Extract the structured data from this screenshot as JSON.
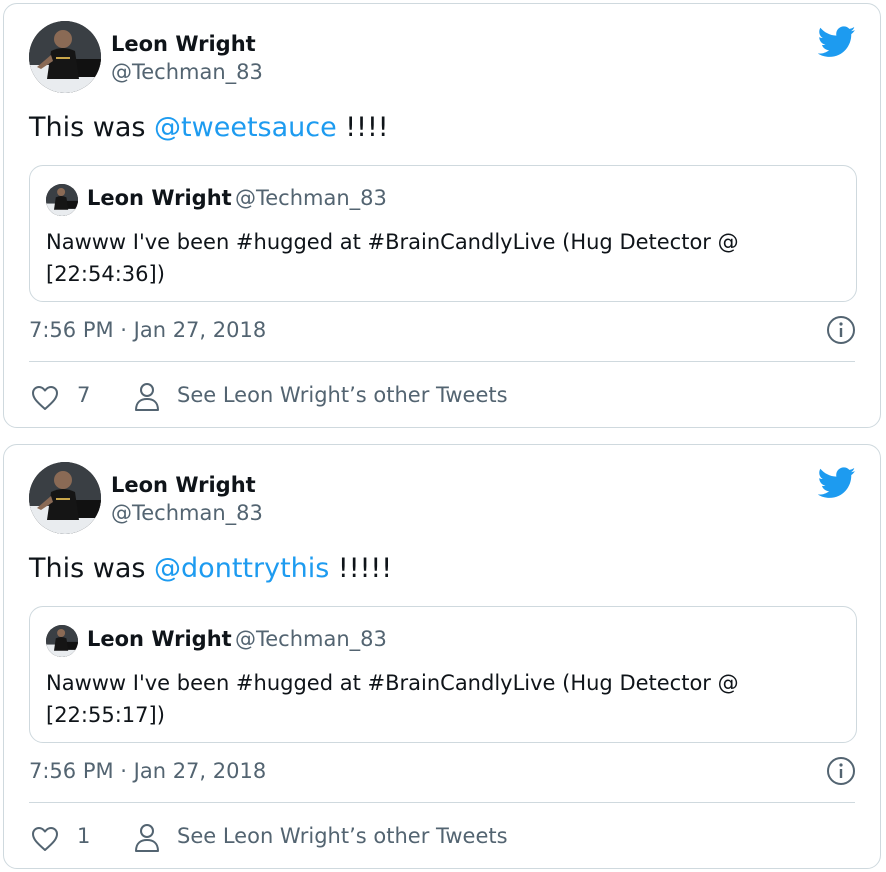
{
  "tweets": [
    {
      "author_name": "Leon Wright",
      "author_handle": "@Techman_83",
      "text_prefix": "This was ",
      "mention": "@tweetsauce",
      "text_suffix": " !!!!",
      "quote": {
        "author_name": "Leon Wright",
        "author_handle": "@Techman_83",
        "text": "Nawww I've been #hugged at #BrainCandlyLive (Hug Detector @ [22:54:36])"
      },
      "timestamp": "7:56 PM · Jan 27, 2018",
      "likes": "7",
      "other_tweets_label": "See Leon Wright’s other Tweets"
    },
    {
      "author_name": "Leon Wright",
      "author_handle": "@Techman_83",
      "text_prefix": "This was ",
      "mention": "@donttrythis",
      "text_suffix": " !!!!!",
      "quote": {
        "author_name": "Leon Wright",
        "author_handle": "@Techman_83",
        "text": "Nawww I've been #hugged at #BrainCandlyLive (Hug Detector @ [22:55:17])"
      },
      "timestamp": "7:56 PM · Jan 27, 2018",
      "likes": "1",
      "other_tweets_label": "See Leon Wright’s other Tweets"
    }
  ],
  "icons": {
    "brand": "twitter-bird-icon",
    "info": "info-icon",
    "like": "heart-icon",
    "profile": "person-icon"
  },
  "colors": {
    "brand_blue": "#1d9bf0",
    "text_primary": "#0f1419",
    "text_secondary": "#536471",
    "border": "#cfd9de"
  }
}
